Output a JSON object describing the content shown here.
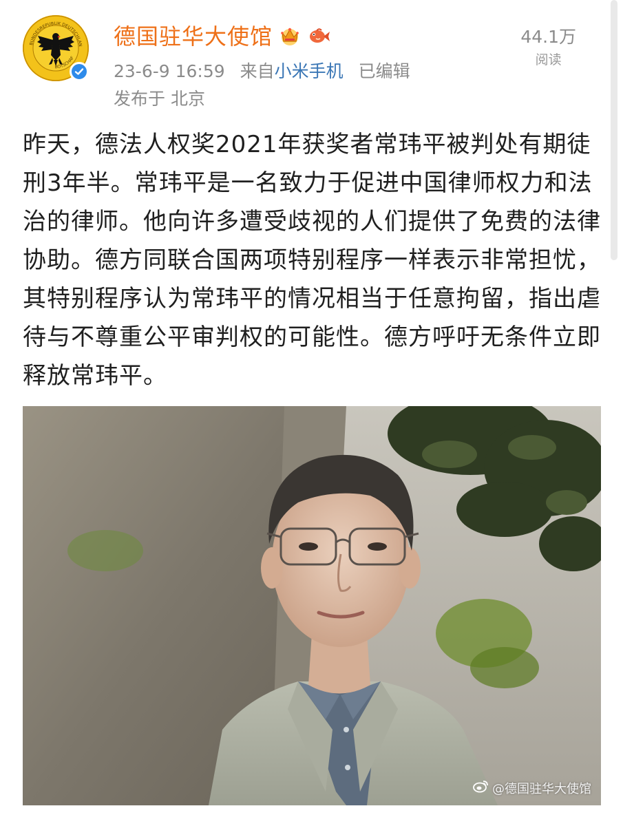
{
  "post": {
    "author": "德国驻华大使馆",
    "timestamp": "23-6-9 16:59",
    "source_prefix": "来自",
    "source_name": "小米手机",
    "edited": "已编辑",
    "location": "发布于 北京",
    "read_count": "44.1万",
    "read_label": "阅读",
    "text": "昨天，德法人权奖2021年获奖者常玮平被判处有期徒刑3年半。常玮平是一名致力于促进中国律师权力和法治的律师。他向许多遭受歧视的人们提供了免费的法律协助。德方同联合国两项特别程序一样表示非常担忧，其特别程序认为常玮平的情况相当于任意拘留，指出虐待与不尊重公平审判权的可能性。德方呼吁无条件立即释放常玮平。",
    "watermark": "@德国驻华大使馆"
  },
  "avatar": {
    "icon": "german-eagle-emblem-icon",
    "seal_text_top": "BUNDESREPUBLIK DEUTSCHLAND",
    "seal_text_bottom": "BOTSCHAFT"
  },
  "colors": {
    "author_name": "#ee7018",
    "source_link": "#3a76b5",
    "meta_gray": "#8b8b8b",
    "verified_blue": "#2e8bea",
    "emblem_gold": "#f3c21a"
  },
  "icons": {
    "verified": "verified-check-icon",
    "member_badge": "crown-badge-icon",
    "fan_badge": "koi-fish-icon",
    "watermark_logo": "weibo-logo-icon"
  }
}
